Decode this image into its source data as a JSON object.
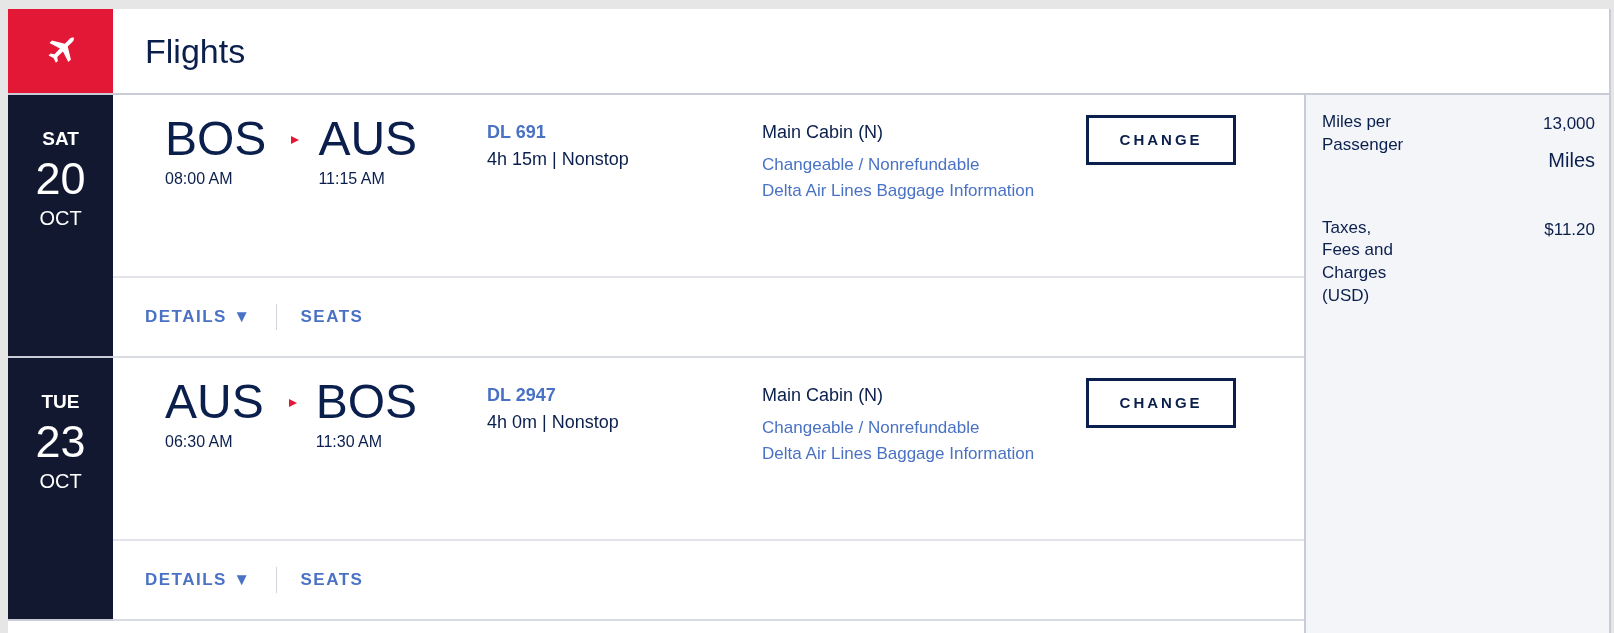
{
  "header": {
    "title": "Flights"
  },
  "flights": [
    {
      "day": "SAT",
      "date": "20",
      "month": "OCT",
      "origin": "BOS",
      "origin_time": "08:00 AM",
      "destination": "AUS",
      "destination_time": "11:15 AM",
      "flight_number": "DL 691",
      "duration": "4h 15m | Nonstop",
      "cabin": "Main Cabin (N)",
      "fare_rules": "Changeable / Nonrefundable",
      "baggage_link": "Delta Air Lines Baggage Information",
      "change_button": "CHANGE",
      "details_link": "DETAILS ▼",
      "seats_link": "SEATS"
    },
    {
      "day": "TUE",
      "date": "23",
      "month": "OCT",
      "origin": "AUS",
      "origin_time": "06:30 AM",
      "destination": "BOS",
      "destination_time": "11:30 AM",
      "flight_number": "DL 2947",
      "duration": "4h 0m | Nonstop",
      "cabin": "Main Cabin (N)",
      "fare_rules": "Changeable / Nonrefundable",
      "baggage_link": "Delta Air Lines Baggage Information",
      "change_button": "CHANGE",
      "details_link": "DETAILS ▼",
      "seats_link": "SEATS"
    }
  ],
  "summary": [
    {
      "label": "Miles per Passenger",
      "value": "13,000",
      "unit": "Miles"
    },
    {
      "label": "Taxes, Fees and Charges (USD)",
      "value": "$11.20"
    }
  ]
}
